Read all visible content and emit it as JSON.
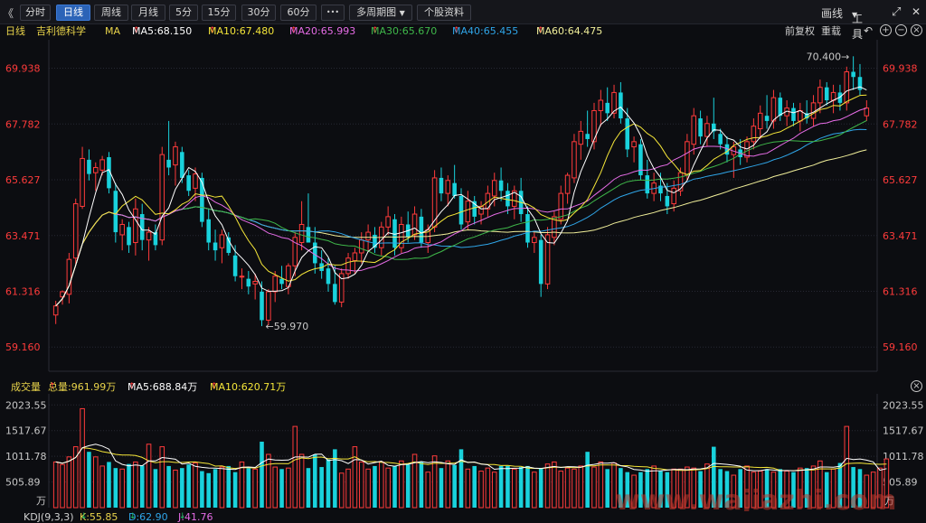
{
  "toolbar": {
    "collapse_glyph": "《",
    "tabs": [
      "分时",
      "日线",
      "周线",
      "月线",
      "5分",
      "15分",
      "30分",
      "60分"
    ],
    "active_tab": "日线",
    "more_glyph": "•••",
    "multi_period": "多周期图",
    "stock_info": "个股资料",
    "draw_line": "画线",
    "tools": "工具",
    "expand_glyph": "⤢",
    "close_glyph": "✕"
  },
  "price_header": {
    "period": "日线",
    "stock_name": "吉利德科学",
    "indicator": "MA",
    "ma5": "MA5:68.150",
    "ma10": "MA10:67.480",
    "ma20": "MA20:65.993",
    "ma30": "MA30:65.670",
    "ma40": "MA40:65.455",
    "ma60": "MA60:64.475",
    "adjust_prev": "前复权",
    "reload": "重载"
  },
  "price_axis": [
    "69.938",
    "67.782",
    "65.627",
    "63.471",
    "61.316",
    "59.160"
  ],
  "annotations": {
    "high": "70.400",
    "low": "59.970"
  },
  "volume_header": {
    "label": "成交量",
    "total": "总量:961.99万",
    "ma5": "MA5:688.84万",
    "ma10": "MA10:620.71万"
  },
  "volume_axis": [
    "2023.55",
    "1517.67",
    "1011.78",
    "505.89"
  ],
  "volume_unit": "万",
  "kdj_header": {
    "label": "KDJ(9,3,3)",
    "k": "K:55.85",
    "d": "D:62.90",
    "j": "J:41.76"
  },
  "watermark": "www.wajiazhi.com",
  "colors": {
    "up": "#ff3b3b",
    "down": "#19d2dc",
    "ma5": "#ffffff",
    "ma10": "#f5e639",
    "ma20": "#e66ce6",
    "ma30": "#3fb84a",
    "ma40": "#2fa5e8",
    "ma60": "#f1ef9a",
    "background": "#0c0d11"
  },
  "chart_data": {
    "type": "candlestick",
    "ylim": [
      58.4,
      70.9
    ],
    "yticks": [
      69.938,
      67.782,
      65.627,
      63.471,
      61.316,
      59.16
    ],
    "high_marker": 70.4,
    "low_marker": 59.97,
    "candles": [
      {
        "o": 60.4,
        "h": 60.95,
        "l": 60.05,
        "c": 60.75
      },
      {
        "o": 61.1,
        "h": 61.35,
        "l": 60.8,
        "c": 61.3
      },
      {
        "o": 61.2,
        "h": 62.8,
        "l": 60.85,
        "c": 62.55
      },
      {
        "o": 62.6,
        "h": 64.9,
        "l": 62.3,
        "c": 64.7
      },
      {
        "o": 64.6,
        "h": 66.9,
        "l": 64.5,
        "c": 66.45
      },
      {
        "o": 66.4,
        "h": 66.8,
        "l": 65.6,
        "c": 65.85
      },
      {
        "o": 65.9,
        "h": 66.3,
        "l": 65.2,
        "c": 66.1
      },
      {
        "o": 66.0,
        "h": 66.55,
        "l": 65.8,
        "c": 66.4
      },
      {
        "o": 66.5,
        "h": 66.7,
        "l": 65.1,
        "c": 65.3
      },
      {
        "o": 65.2,
        "h": 65.5,
        "l": 63.2,
        "c": 63.6
      },
      {
        "o": 63.5,
        "h": 64.1,
        "l": 62.9,
        "c": 63.9
      },
      {
        "o": 63.8,
        "h": 64.0,
        "l": 62.8,
        "c": 63.1
      },
      {
        "o": 63.2,
        "h": 64.9,
        "l": 62.7,
        "c": 64.5
      },
      {
        "o": 64.3,
        "h": 64.7,
        "l": 62.9,
        "c": 63.3
      },
      {
        "o": 63.3,
        "h": 63.8,
        "l": 62.5,
        "c": 63.6
      },
      {
        "o": 63.6,
        "h": 63.9,
        "l": 62.9,
        "c": 63.1
      },
      {
        "o": 63.3,
        "h": 66.9,
        "l": 63.1,
        "c": 66.6
      },
      {
        "o": 66.4,
        "h": 67.9,
        "l": 65.8,
        "c": 66.1
      },
      {
        "o": 66.2,
        "h": 67.1,
        "l": 65.4,
        "c": 66.9
      },
      {
        "o": 66.7,
        "h": 66.9,
        "l": 65.5,
        "c": 65.7
      },
      {
        "o": 65.8,
        "h": 66.0,
        "l": 65.0,
        "c": 65.2
      },
      {
        "o": 65.3,
        "h": 66.1,
        "l": 64.8,
        "c": 65.85
      },
      {
        "o": 65.7,
        "h": 65.9,
        "l": 63.8,
        "c": 64.0
      },
      {
        "o": 64.1,
        "h": 64.5,
        "l": 62.9,
        "c": 63.2
      },
      {
        "o": 63.2,
        "h": 63.7,
        "l": 62.5,
        "c": 62.9
      },
      {
        "o": 63.0,
        "h": 63.7,
        "l": 62.4,
        "c": 63.5
      },
      {
        "o": 63.4,
        "h": 63.6,
        "l": 62.7,
        "c": 62.8
      },
      {
        "o": 62.7,
        "h": 63.1,
        "l": 61.7,
        "c": 61.9
      },
      {
        "o": 61.9,
        "h": 62.2,
        "l": 61.4,
        "c": 61.9
      },
      {
        "o": 61.8,
        "h": 62.1,
        "l": 61.2,
        "c": 61.5
      },
      {
        "o": 61.6,
        "h": 62.0,
        "l": 61.0,
        "c": 61.7
      },
      {
        "o": 61.3,
        "h": 61.7,
        "l": 59.97,
        "c": 60.2
      },
      {
        "o": 60.2,
        "h": 61.4,
        "l": 60.0,
        "c": 61.3
      },
      {
        "o": 61.3,
        "h": 62.1,
        "l": 60.9,
        "c": 61.9
      },
      {
        "o": 61.8,
        "h": 62.3,
        "l": 61.4,
        "c": 61.6
      },
      {
        "o": 61.5,
        "h": 62.4,
        "l": 61.2,
        "c": 62.3
      },
      {
        "o": 62.3,
        "h": 63.6,
        "l": 61.9,
        "c": 63.4
      },
      {
        "o": 63.2,
        "h": 64.8,
        "l": 62.9,
        "c": 63.9
      },
      {
        "o": 63.8,
        "h": 65.1,
        "l": 63.5,
        "c": 63.2
      },
      {
        "o": 63.2,
        "h": 63.8,
        "l": 62.0,
        "c": 62.4
      },
      {
        "o": 62.4,
        "h": 62.9,
        "l": 61.8,
        "c": 62.1
      },
      {
        "o": 62.2,
        "h": 62.6,
        "l": 61.3,
        "c": 61.6
      },
      {
        "o": 61.6,
        "h": 62.3,
        "l": 60.8,
        "c": 60.9
      },
      {
        "o": 60.9,
        "h": 62.2,
        "l": 60.7,
        "c": 62.0
      },
      {
        "o": 62.0,
        "h": 62.8,
        "l": 61.8,
        "c": 62.6
      },
      {
        "o": 62.5,
        "h": 63.0,
        "l": 62.0,
        "c": 62.8
      },
      {
        "o": 62.8,
        "h": 63.6,
        "l": 62.4,
        "c": 63.3
      },
      {
        "o": 63.3,
        "h": 63.9,
        "l": 62.9,
        "c": 63.6
      },
      {
        "o": 63.5,
        "h": 63.8,
        "l": 62.8,
        "c": 63.0
      },
      {
        "o": 63.0,
        "h": 64.0,
        "l": 62.7,
        "c": 63.8
      },
      {
        "o": 63.8,
        "h": 64.6,
        "l": 63.5,
        "c": 64.2
      },
      {
        "o": 64.1,
        "h": 64.3,
        "l": 62.7,
        "c": 63.0
      },
      {
        "o": 63.0,
        "h": 64.2,
        "l": 62.8,
        "c": 63.9
      },
      {
        "o": 63.9,
        "h": 64.4,
        "l": 63.2,
        "c": 63.4
      },
      {
        "o": 63.5,
        "h": 64.6,
        "l": 63.3,
        "c": 64.3
      },
      {
        "o": 64.2,
        "h": 64.5,
        "l": 63.0,
        "c": 63.2
      },
      {
        "o": 63.2,
        "h": 63.9,
        "l": 62.8,
        "c": 63.7
      },
      {
        "o": 63.8,
        "h": 66.0,
        "l": 63.6,
        "c": 65.7
      },
      {
        "o": 65.7,
        "h": 66.1,
        "l": 64.8,
        "c": 65.1
      },
      {
        "o": 65.1,
        "h": 65.8,
        "l": 64.6,
        "c": 65.6
      },
      {
        "o": 65.5,
        "h": 66.2,
        "l": 64.9,
        "c": 65.0
      },
      {
        "o": 65.0,
        "h": 65.3,
        "l": 63.7,
        "c": 63.9
      },
      {
        "o": 64.0,
        "h": 65.2,
        "l": 63.7,
        "c": 64.8
      },
      {
        "o": 64.8,
        "h": 65.0,
        "l": 63.9,
        "c": 64.2
      },
      {
        "o": 64.3,
        "h": 64.8,
        "l": 63.9,
        "c": 64.6
      },
      {
        "o": 64.5,
        "h": 65.4,
        "l": 64.2,
        "c": 65.1
      },
      {
        "o": 65.0,
        "h": 65.9,
        "l": 64.6,
        "c": 65.6
      },
      {
        "o": 65.6,
        "h": 66.1,
        "l": 64.8,
        "c": 65.2
      },
      {
        "o": 65.2,
        "h": 65.5,
        "l": 64.3,
        "c": 64.6
      },
      {
        "o": 64.6,
        "h": 65.4,
        "l": 64.1,
        "c": 65.2
      },
      {
        "o": 65.2,
        "h": 65.7,
        "l": 64.0,
        "c": 64.3
      },
      {
        "o": 64.3,
        "h": 64.6,
        "l": 63.0,
        "c": 63.2
      },
      {
        "o": 63.2,
        "h": 63.6,
        "l": 62.8,
        "c": 63.4
      },
      {
        "o": 63.3,
        "h": 63.5,
        "l": 61.1,
        "c": 61.6
      },
      {
        "o": 61.6,
        "h": 63.8,
        "l": 61.4,
        "c": 63.5
      },
      {
        "o": 63.4,
        "h": 64.4,
        "l": 63.1,
        "c": 64.2
      },
      {
        "o": 64.1,
        "h": 65.4,
        "l": 63.9,
        "c": 65.1
      },
      {
        "o": 65.1,
        "h": 65.9,
        "l": 64.7,
        "c": 65.8
      },
      {
        "o": 65.7,
        "h": 67.4,
        "l": 65.5,
        "c": 67.1
      },
      {
        "o": 67.0,
        "h": 67.9,
        "l": 66.4,
        "c": 67.5
      },
      {
        "o": 67.4,
        "h": 68.3,
        "l": 66.9,
        "c": 67.2
      },
      {
        "o": 67.1,
        "h": 68.6,
        "l": 66.8,
        "c": 68.3
      },
      {
        "o": 68.3,
        "h": 69.1,
        "l": 67.7,
        "c": 68.7
      },
      {
        "o": 68.6,
        "h": 69.2,
        "l": 67.9,
        "c": 68.2
      },
      {
        "o": 68.2,
        "h": 69.3,
        "l": 68.0,
        "c": 69.0
      },
      {
        "o": 69.0,
        "h": 69.4,
        "l": 67.8,
        "c": 68.0
      },
      {
        "o": 68.0,
        "h": 68.4,
        "l": 66.5,
        "c": 66.8
      },
      {
        "o": 66.9,
        "h": 67.3,
        "l": 66.3,
        "c": 67.1
      },
      {
        "o": 67.0,
        "h": 67.2,
        "l": 65.6,
        "c": 65.8
      },
      {
        "o": 65.8,
        "h": 66.4,
        "l": 64.9,
        "c": 65.1
      },
      {
        "o": 65.1,
        "h": 65.9,
        "l": 64.8,
        "c": 65.5
      },
      {
        "o": 65.4,
        "h": 65.9,
        "l": 64.8,
        "c": 65.1
      },
      {
        "o": 65.0,
        "h": 65.5,
        "l": 64.3,
        "c": 64.6
      },
      {
        "o": 64.7,
        "h": 65.6,
        "l": 64.4,
        "c": 65.3
      },
      {
        "o": 65.2,
        "h": 66.1,
        "l": 65.0,
        "c": 65.9
      },
      {
        "o": 65.8,
        "h": 67.4,
        "l": 65.6,
        "c": 67.1
      },
      {
        "o": 67.0,
        "h": 68.4,
        "l": 66.6,
        "c": 68.1
      },
      {
        "o": 68.0,
        "h": 68.3,
        "l": 67.0,
        "c": 67.3
      },
      {
        "o": 67.3,
        "h": 68.1,
        "l": 66.9,
        "c": 67.8
      },
      {
        "o": 67.8,
        "h": 68.8,
        "l": 67.2,
        "c": 67.5
      },
      {
        "o": 67.4,
        "h": 67.6,
        "l": 66.8,
        "c": 67.0
      },
      {
        "o": 67.0,
        "h": 67.3,
        "l": 66.3,
        "c": 66.6
      },
      {
        "o": 66.6,
        "h": 67.1,
        "l": 65.7,
        "c": 66.9
      },
      {
        "o": 66.8,
        "h": 67.2,
        "l": 66.2,
        "c": 66.5
      },
      {
        "o": 66.5,
        "h": 67.3,
        "l": 66.3,
        "c": 67.1
      },
      {
        "o": 67.1,
        "h": 68.0,
        "l": 66.8,
        "c": 67.7
      },
      {
        "o": 67.6,
        "h": 68.5,
        "l": 67.2,
        "c": 68.2
      },
      {
        "o": 68.1,
        "h": 68.9,
        "l": 67.6,
        "c": 67.9
      },
      {
        "o": 67.9,
        "h": 69.1,
        "l": 67.6,
        "c": 68.8
      },
      {
        "o": 68.8,
        "h": 69.0,
        "l": 67.9,
        "c": 68.1
      },
      {
        "o": 68.1,
        "h": 68.7,
        "l": 67.7,
        "c": 68.4
      },
      {
        "o": 68.4,
        "h": 68.6,
        "l": 67.7,
        "c": 67.9
      },
      {
        "o": 67.9,
        "h": 68.6,
        "l": 67.5,
        "c": 68.3
      },
      {
        "o": 68.2,
        "h": 68.7,
        "l": 67.8,
        "c": 68.0
      },
      {
        "o": 68.0,
        "h": 68.9,
        "l": 67.7,
        "c": 68.6
      },
      {
        "o": 68.6,
        "h": 69.5,
        "l": 68.2,
        "c": 69.2
      },
      {
        "o": 69.2,
        "h": 69.4,
        "l": 68.5,
        "c": 68.7
      },
      {
        "o": 68.7,
        "h": 69.3,
        "l": 68.2,
        "c": 69.0
      },
      {
        "o": 69.0,
        "h": 69.3,
        "l": 68.3,
        "c": 68.6
      },
      {
        "o": 68.6,
        "h": 70.0,
        "l": 68.3,
        "c": 69.8
      },
      {
        "o": 69.8,
        "h": 70.4,
        "l": 69.1,
        "c": 69.6
      },
      {
        "o": 69.6,
        "h": 70.1,
        "l": 68.9,
        "c": 69.1
      },
      {
        "o": 68.1,
        "h": 68.7,
        "l": 67.9,
        "c": 68.4
      }
    ],
    "volume": {
      "ylim": [
        0,
        2100
      ],
      "yticks": [
        2023.55,
        1517.67,
        1011.78,
        505.89
      ],
      "values": [
        900,
        850,
        1000,
        1200,
        1950,
        1100,
        1000,
        820,
        900,
        780,
        760,
        860,
        900,
        830,
        1250,
        760,
        1200,
        820,
        740,
        780,
        850,
        880,
        720,
        680,
        760,
        800,
        820,
        700,
        900,
        780,
        760,
        1300,
        1050,
        800,
        760,
        780,
        1600,
        1050,
        780,
        1050,
        800,
        950,
        1150,
        680,
        760,
        1200,
        900,
        760,
        820,
        900,
        780,
        820,
        920,
        850,
        1050,
        900,
        700,
        1020,
        780,
        920,
        840,
        1150,
        760,
        820,
        720,
        780,
        700,
        820,
        820,
        760,
        800,
        820,
        700,
        780,
        860,
        900,
        720,
        780,
        760,
        820,
        1100,
        800,
        900,
        760,
        880,
        780,
        700,
        640,
        700,
        760,
        820,
        720,
        700,
        760,
        760,
        800,
        780,
        720,
        860,
        1200,
        760,
        720,
        640,
        760,
        820,
        700,
        720,
        760,
        700,
        760,
        720,
        700,
        780,
        780,
        820,
        920,
        700,
        760,
        880,
        1600,
        800,
        760,
        640,
        700,
        780,
        960
      ]
    }
  }
}
